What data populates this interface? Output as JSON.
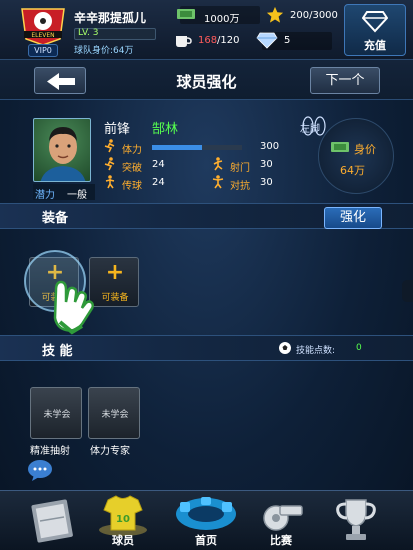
{
  "header": {
    "player_name": "辛辛那提孤儿",
    "logo_text": "ELEVEN",
    "vip": "VIP0",
    "level": "LV. 3",
    "team_value": "球队身价:64万",
    "money": "1000万",
    "stars": "200/3000",
    "stamina_current": "168",
    "stamina_total": "/120",
    "gems": "5",
    "recharge_label": "充值"
  },
  "titlebar": {
    "title": "球员强化",
    "next_label": "下一个"
  },
  "player": {
    "position": "前锋",
    "name": "郜林",
    "potential_label": "潜力",
    "potential_value": "一般",
    "foot": "左脚",
    "value_label": "身价",
    "value": "64万",
    "stamina_label": "体力",
    "stamina_value": "300",
    "stamina_fraction": 0.55,
    "attrs": {
      "breakthrough_label": "突破",
      "breakthrough_value": "24",
      "shooting_label": "射门",
      "shooting_value": "30",
      "passing_label": "传球",
      "passing_value": "24",
      "defense_label": "对抗",
      "defense_value": "30"
    }
  },
  "equipment": {
    "section_title": "装备",
    "strengthen_label": "强化",
    "slot1": "可装备",
    "slot2": "可装备"
  },
  "skills": {
    "section_title": "技 能",
    "points_label": "技能点数:",
    "points_value": "0",
    "items": [
      {
        "status": "未学会",
        "name": "精准抽射"
      },
      {
        "status": "未学会",
        "name": "体力专家"
      }
    ]
  },
  "nav": {
    "players": "球员",
    "home": "首页",
    "match": "比赛"
  },
  "colors": {
    "accent_orange": "#ffae2e",
    "name_green": "#56ff4e",
    "slot_gold": "#f6b51e"
  }
}
